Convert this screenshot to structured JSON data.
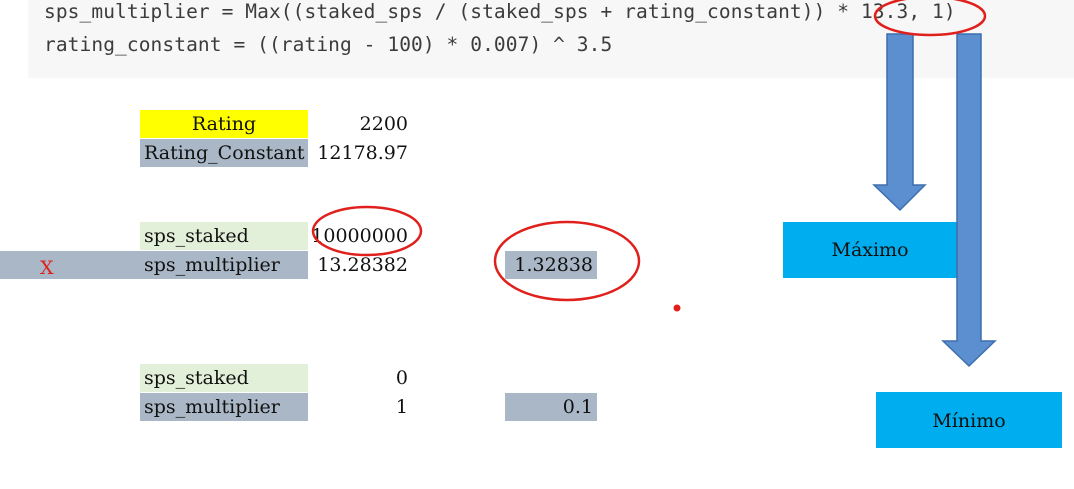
{
  "code": {
    "line1": "sps_multiplier = Max((staked_sps / (staked_sps + rating_constant)) * 13.3, 1)",
    "line2": "rating_constant = ((rating - 100) * 0.007) ^ 3.5"
  },
  "table1": {
    "rating_label": "Rating",
    "rating_value": "2200",
    "constant_label": "Rating_Constant",
    "constant_value": "12178.97"
  },
  "table2": {
    "x_mark": "X",
    "staked_label": "sps_staked",
    "staked_value": "10000000",
    "multiplier_label": "sps_multiplier",
    "multiplier_value": "13.28382",
    "scaled_value": "1.32838"
  },
  "table3": {
    "staked_label": "sps_staked",
    "staked_value": "0",
    "multiplier_label": "sps_multiplier",
    "multiplier_value": "1",
    "scaled_value": "0.1"
  },
  "boxes": {
    "maximo": "Máximo",
    "minimo": "Mínimo"
  },
  "colors": {
    "highlight_yellow": "#ffff00",
    "cell_steel": "#a9b7c6",
    "cell_light_green": "#e2efd9",
    "box_blue": "#00aeef",
    "arrow_blue": "#5b8fd0",
    "annotation_red": "#e0201c"
  }
}
